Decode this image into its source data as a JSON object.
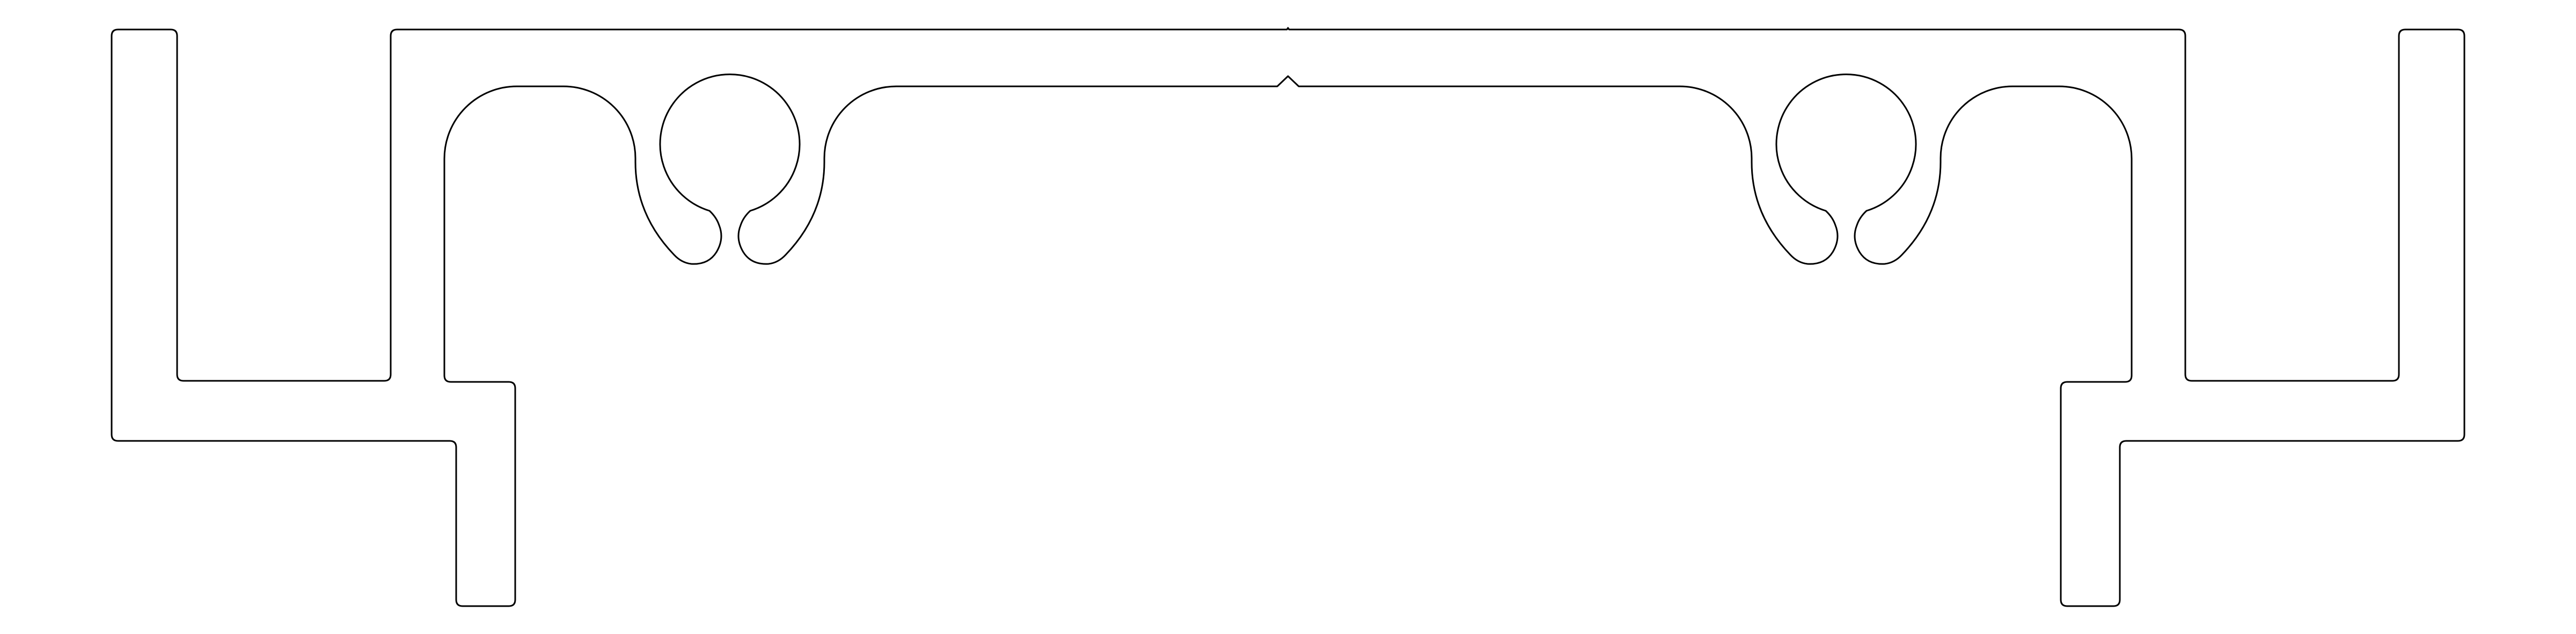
{
  "drawing": {
    "subject": "extrusion-profile-cross-section",
    "background_color": "#ffffff",
    "line_color": "#000000",
    "symmetry": "mirror-vertical-axis",
    "visible_text": []
  }
}
